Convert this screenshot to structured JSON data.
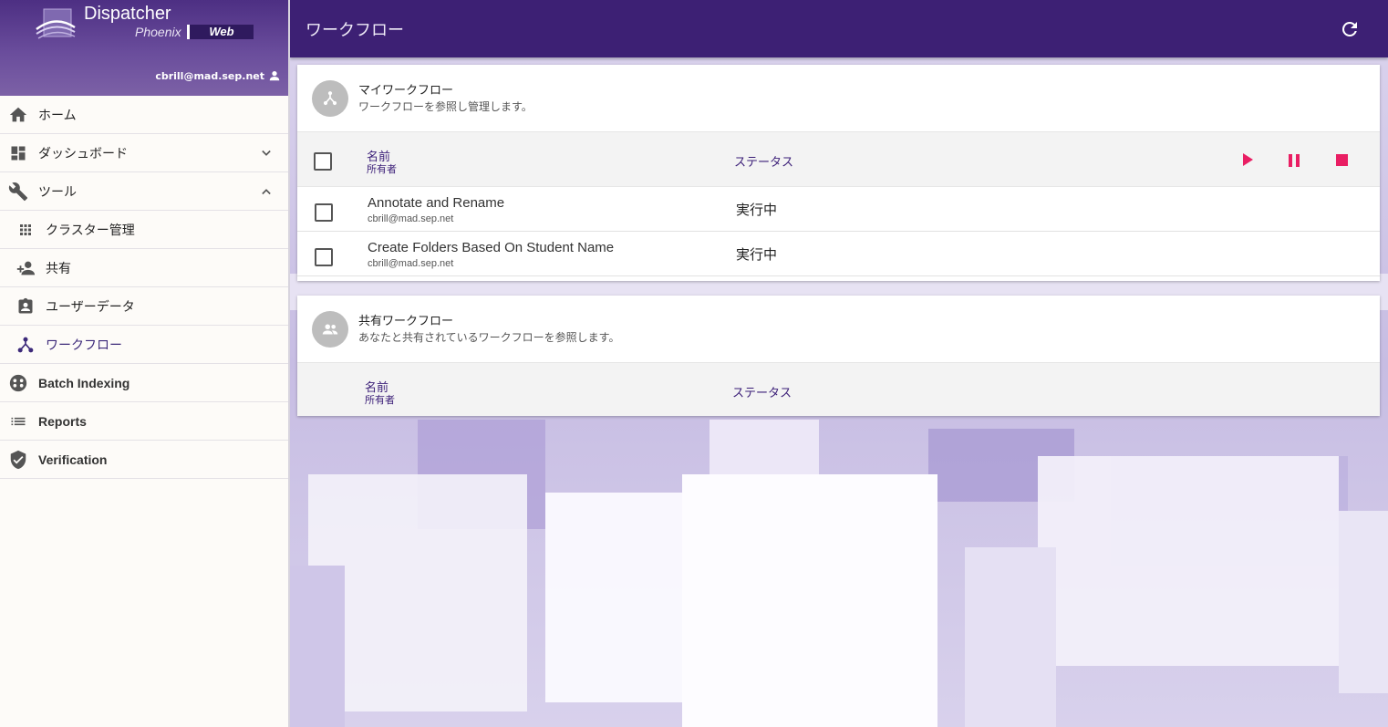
{
  "app": {
    "title": "Dispatcher",
    "subtitle": "Phoenix",
    "edition": "Web"
  },
  "user": {
    "email": "cbrill@mad.sep.net"
  },
  "sidebar": {
    "items": [
      {
        "label": "ホーム",
        "icon": "home-icon"
      },
      {
        "label": "ダッシュボード",
        "icon": "dashboard-icon"
      },
      {
        "label": "ツール",
        "icon": "wrench-icon"
      },
      {
        "label": "クラスター管理",
        "icon": "grid-icon"
      },
      {
        "label": "共有",
        "icon": "person-add-icon"
      },
      {
        "label": "ユーザーデータ",
        "icon": "assignment-ind-icon"
      },
      {
        "label": "ワークフロー",
        "icon": "workflow-icon"
      },
      {
        "label": "Batch Indexing",
        "icon": "batch-icon"
      },
      {
        "label": "Reports",
        "icon": "list-icon"
      },
      {
        "label": "Verification",
        "icon": "shield-check-icon"
      }
    ]
  },
  "header": {
    "title": "ワークフロー"
  },
  "my_workflows": {
    "title": "マイワークフロー",
    "subtitle": "ワークフローを参照し管理します。",
    "col_name": "名前",
    "col_owner": "所有者",
    "col_status": "ステータス",
    "rows": [
      {
        "name": "Annotate and Rename",
        "owner": "cbrill@mad.sep.net",
        "status": "実行中"
      },
      {
        "name": "Create Folders Based On Student Name",
        "owner": "cbrill@mad.sep.net",
        "status": "実行中"
      }
    ]
  },
  "shared_workflows": {
    "title": "共有ワークフロー",
    "subtitle": "あなたと共有されているワークフローを参照します。",
    "col_name": "名前",
    "col_owner": "所有者",
    "col_status": "ステータス"
  },
  "colors": {
    "primary": "#3d2074",
    "accent": "#e91e63",
    "link": "#3a1d77"
  }
}
